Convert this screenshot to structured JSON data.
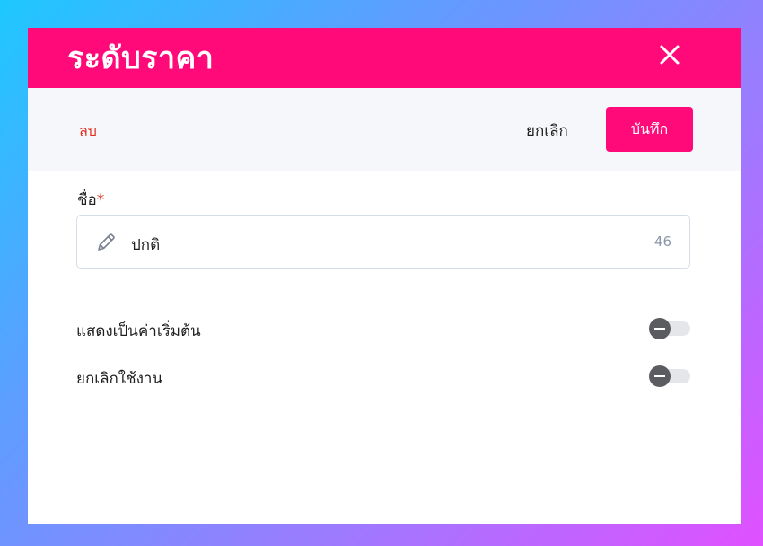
{
  "dialog": {
    "title": "ระดับราคา",
    "close_icon": "close-icon"
  },
  "toolbar": {
    "delete_label": "ลบ",
    "cancel_label": "ยกเลิก",
    "save_label": "บันทึก"
  },
  "form": {
    "name_label": "ชื่อ",
    "required_mark": "*",
    "name_value": "ปกติ",
    "name_remaining": "46",
    "name_icon": "pencil-icon",
    "toggles": [
      {
        "label": "แสดงเป็นค่าเริ่มต้น",
        "on": false
      },
      {
        "label": "ยกเลิกใช้งาน",
        "on": false
      }
    ]
  },
  "colors": {
    "accent": "#ff0a78",
    "danger": "#e0301f",
    "toolbar_bg": "#f6f7fa"
  }
}
